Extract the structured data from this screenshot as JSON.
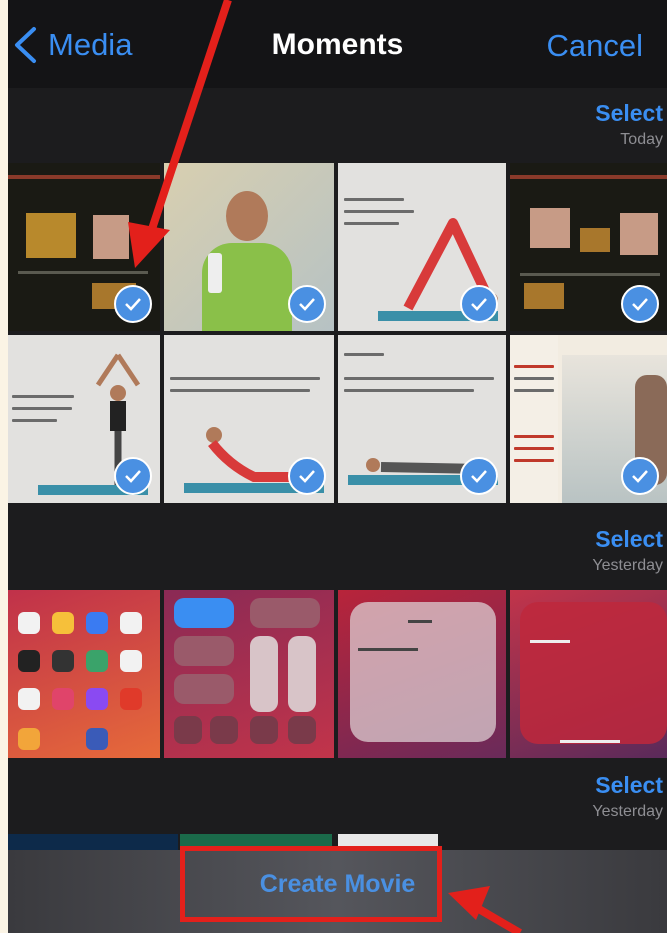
{
  "nav": {
    "back_label": "Media",
    "title": "Moments",
    "cancel_label": "Cancel"
  },
  "sections": [
    {
      "select_label": "Select",
      "date_label": "Today"
    },
    {
      "select_label": "Select",
      "date_label": "Yesterday"
    },
    {
      "select_label": "Select",
      "date_label": "Yesterday"
    }
  ],
  "bottom_bar": {
    "create_movie_label": "Create Movie"
  },
  "colors": {
    "accent": "#3a8ef2",
    "annotation": "#e3201b",
    "background": "#1c1c1e"
  }
}
